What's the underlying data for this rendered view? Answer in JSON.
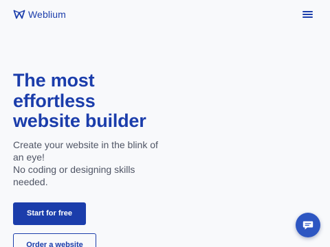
{
  "header": {
    "logo_text": "Weblium",
    "logo_icon": "weblium-logo-icon",
    "menu_icon": "hamburger-menu-icon"
  },
  "hero": {
    "title_lines": [
      "The most",
      "effortless",
      "website builder"
    ],
    "subtitle_lines": [
      "Create your website in the blink of",
      "an eye!",
      "No coding or designing skills",
      "needed."
    ],
    "primary_cta": "Start for free",
    "secondary_cta": "Order a website"
  },
  "chat": {
    "icon": "chat-bubble-icon"
  },
  "colors": {
    "brand": "#1b3dab",
    "chat": "#2d56c2",
    "background": "#f8f9fb",
    "subtitle_text": "#4f5565"
  }
}
